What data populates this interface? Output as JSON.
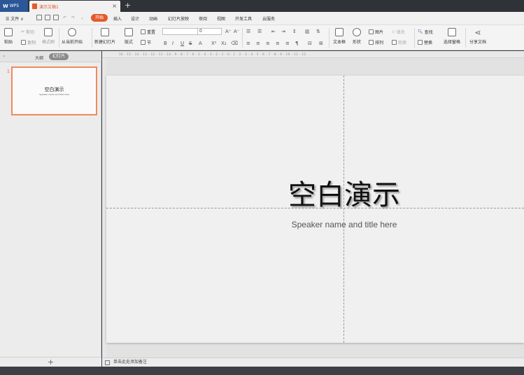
{
  "tabs": {
    "app_tab": "WPS",
    "doc_tab": "演示文稿1",
    "close": "×",
    "new_tab": "+"
  },
  "menu": {
    "file": "☰ 文件 ∨",
    "items": [
      "开始",
      "插入",
      "设计",
      "动画",
      "幻灯片放映",
      "审阅",
      "视图",
      "开发工具",
      "云服务"
    ]
  },
  "ribbon": {
    "paste": "粘贴",
    "cut": "剪切",
    "copy": "复制",
    "format_painter": "格式刷",
    "from_current": "从当前开始",
    "new_slide": "新建幻灯片",
    "layout": "版式",
    "reset": "重置",
    "section": "节",
    "font_size": "0",
    "text_box": "文本框",
    "shape": "形状",
    "picture": "图片",
    "fill": "填充",
    "arrange": "排列",
    "outline": "轮廓",
    "find": "查找",
    "replace": "替换",
    "select_pane": "选择窗格",
    "share": "分享文档"
  },
  "left_panel": {
    "outline_tab": "大纲",
    "slides_tab": "幻灯片",
    "slide_number": "1",
    "thumb_title": "空白演示",
    "thumb_subtitle": "Speaker name and title here",
    "add_button": "+"
  },
  "ruler": {
    "text": "16 · 15 · 14 · 13 · 12 · 11 · 10 · 9 · 8 · 7 · 6 · 5 · 4 · 3 · 2 · 1 · 0 · 1 · 2 · 3 · 4 · 5 · 6 · 7 · 8 · 9 · 10 · 11 · 12"
  },
  "slide": {
    "title": "空白演示",
    "subtitle": "Speaker name and title here"
  },
  "notes": {
    "placeholder": "单击此处添加备注"
  },
  "colors": {
    "accent": "#e25a2d",
    "wps_blue": "#2b5796"
  }
}
